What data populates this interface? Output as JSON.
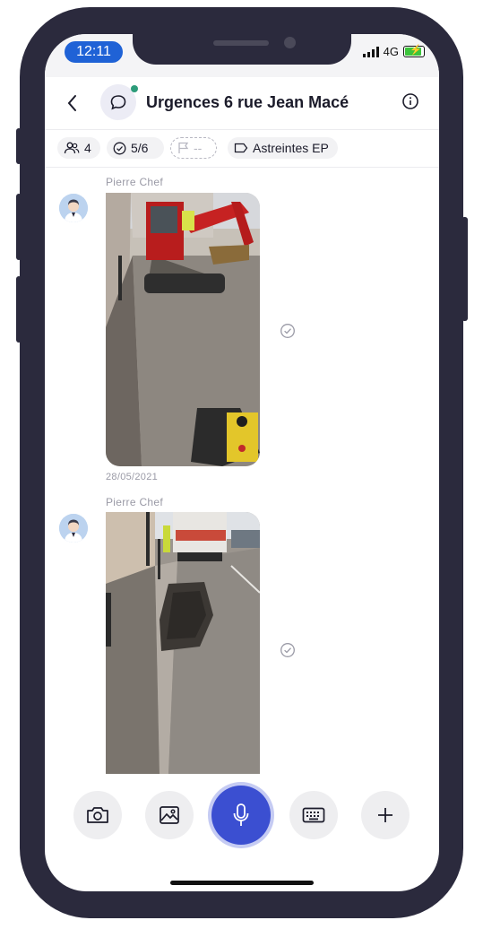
{
  "status": {
    "time": "12:11",
    "network": "4G"
  },
  "header": {
    "title": "Urgences 6 rue Jean Macé"
  },
  "chips": {
    "members": "4",
    "tasks": "5/6",
    "flag": "--",
    "label": "Astreintes EP"
  },
  "messages": [
    {
      "author": "Pierre Chef",
      "date": "28/05/2021"
    },
    {
      "author": "Pierre Chef"
    }
  ],
  "icons": {
    "back": "chevron-left-icon",
    "chat": "chat-bubble-icon",
    "info": "info-icon",
    "members": "users-icon",
    "tasks": "check-circle-icon",
    "flag": "flag-icon",
    "label": "tag-icon",
    "camera": "camera-icon",
    "gallery": "image-icon",
    "mic": "microphone-icon",
    "keyboard": "keyboard-icon",
    "add": "plus-icon"
  },
  "colors": {
    "accent": "#3b4fd1",
    "time_pill": "#1f62d6",
    "online": "#2d9c7a",
    "frame": "#2b2a3d"
  }
}
